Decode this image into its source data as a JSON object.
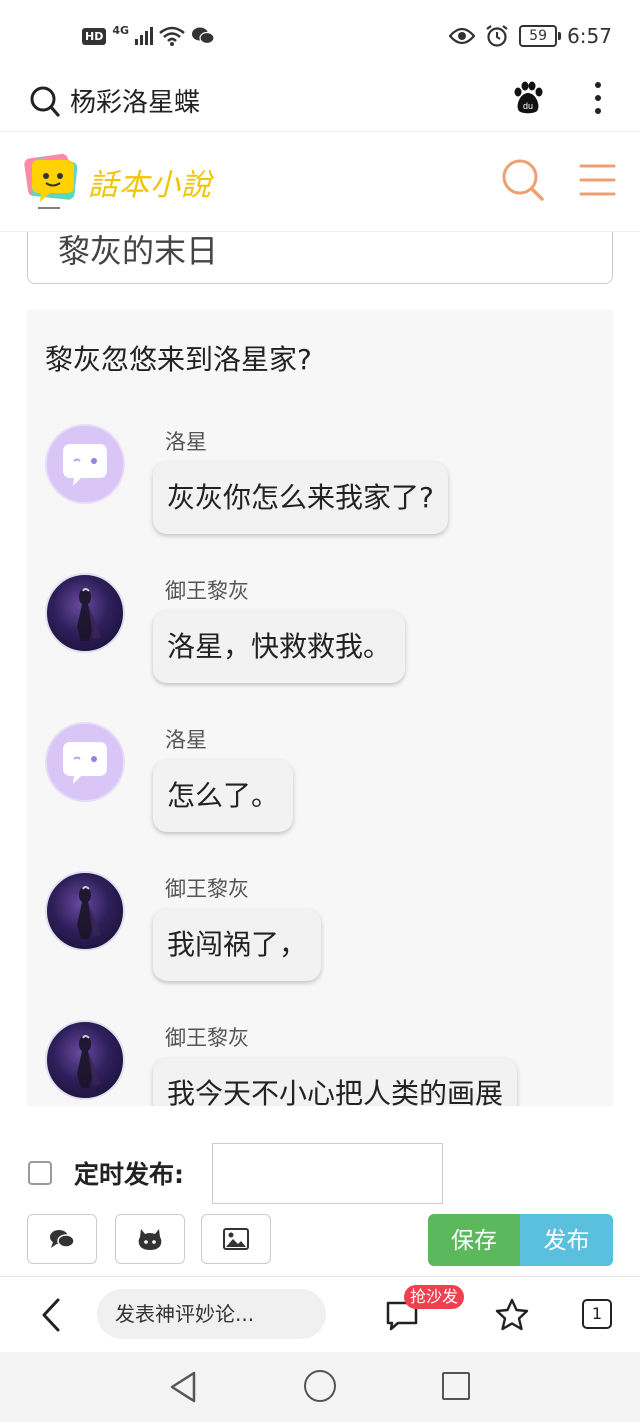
{
  "status_bar": {
    "hd": "HD",
    "network": "4G",
    "battery": "59",
    "time": "6:57"
  },
  "search": {
    "query": "杨彩洛星蝶"
  },
  "site": {
    "logo_text": "話本小說",
    "accent_color": "#f0a070"
  },
  "post": {
    "title": "黎灰的末日",
    "heading": "黎灰忽悠来到洛星家?",
    "messages": [
      {
        "sender": "洛星",
        "text": "灰灰你怎么来我家了?",
        "avatar": "ghost-avatar"
      },
      {
        "sender": "御王黎灰",
        "text": "洛星，快救救我。",
        "avatar": "character-avatar"
      },
      {
        "sender": "洛星",
        "text": "怎么了。",
        "avatar": "ghost-avatar"
      },
      {
        "sender": "御王黎灰",
        "text": "我闯祸了，",
        "avatar": "character-avatar"
      },
      {
        "sender": "御王黎灰",
        "text": "我今天不小心把人类的画展",
        "avatar": "character-avatar"
      }
    ]
  },
  "publish": {
    "schedule_label": "定时发布:",
    "schedule_value": "",
    "save_label": "保存",
    "publish_label": "发布",
    "save_color": "#5cb85c",
    "publish_color": "#5bc0de"
  },
  "bottom_bar": {
    "comment_placeholder": "发表神评妙论...",
    "sofa_badge": "抢沙发",
    "tab_count": "1"
  }
}
